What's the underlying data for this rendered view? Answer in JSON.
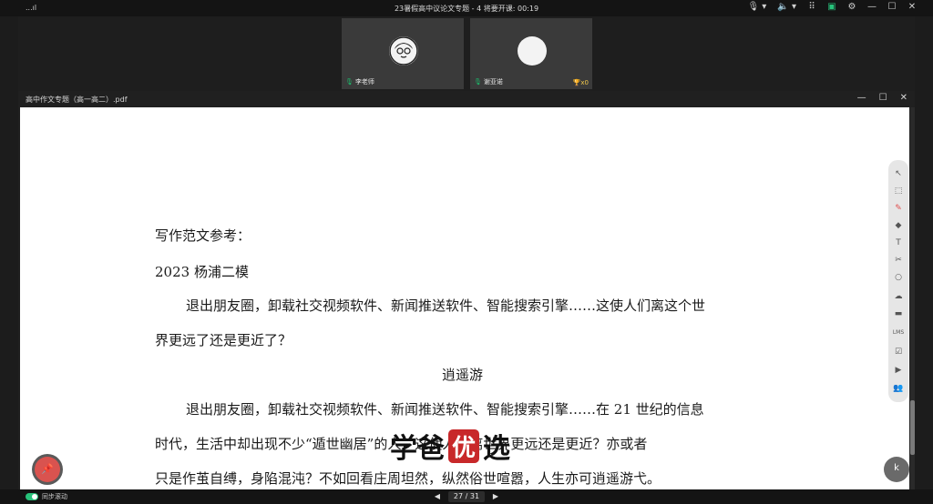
{
  "topbar": {
    "signal": "...ıl",
    "title": "23暑假高中议论文专题 - 4   将要开课: 00:19",
    "controls": [
      "🎙 ▾",
      "🔈 ▾",
      "⠿",
      "▣",
      "⚙",
      "—",
      "☐",
      "✕"
    ]
  },
  "participants": [
    {
      "name": "李老师",
      "mic": "🎙"
    },
    {
      "name": "谢亚诺",
      "mic": "🎙",
      "badge": "🏆x0"
    }
  ],
  "doc": {
    "filename": "高中作文专题（高一高二）.pdf",
    "window_controls": [
      "—",
      "☐",
      "✕"
    ],
    "lines": [
      "写作范文参考：",
      "2023 杨浦二模",
      "退出朋友圈，卸载社交视频软件、新闻推送软件、智能搜索引擎……这使人们离这个世",
      "界更远了还是更近了？",
      "逍遥游",
      "退出朋友圈，卸载社交视频软件、新闻推送软件、智能搜索引擎……在 21 世纪的信息",
      "时代，生活中却出现不少“遁世幽居”的人，这使人们离世界更远还是更近？亦或者",
      "只是作茧自缚，身陷混沌？不如回看庄周坦然，纵然俗世喧嚣，人生亦可逍遥游弋。"
    ]
  },
  "toolbar": {
    "tools": [
      "↖",
      "⬚",
      "✎",
      "◆",
      "T",
      "✂",
      "○",
      "☁",
      "▬",
      "LMS",
      "☑",
      "▶",
      "👥"
    ]
  },
  "bottombar": {
    "sync_label": "同步滚动",
    "prev": "◀",
    "page": "27 / 31",
    "next": "▶"
  },
  "pin_button": "📌",
  "logo_button": "k",
  "watermark": {
    "left": "学爸",
    "mid": "优",
    "right": "选"
  }
}
